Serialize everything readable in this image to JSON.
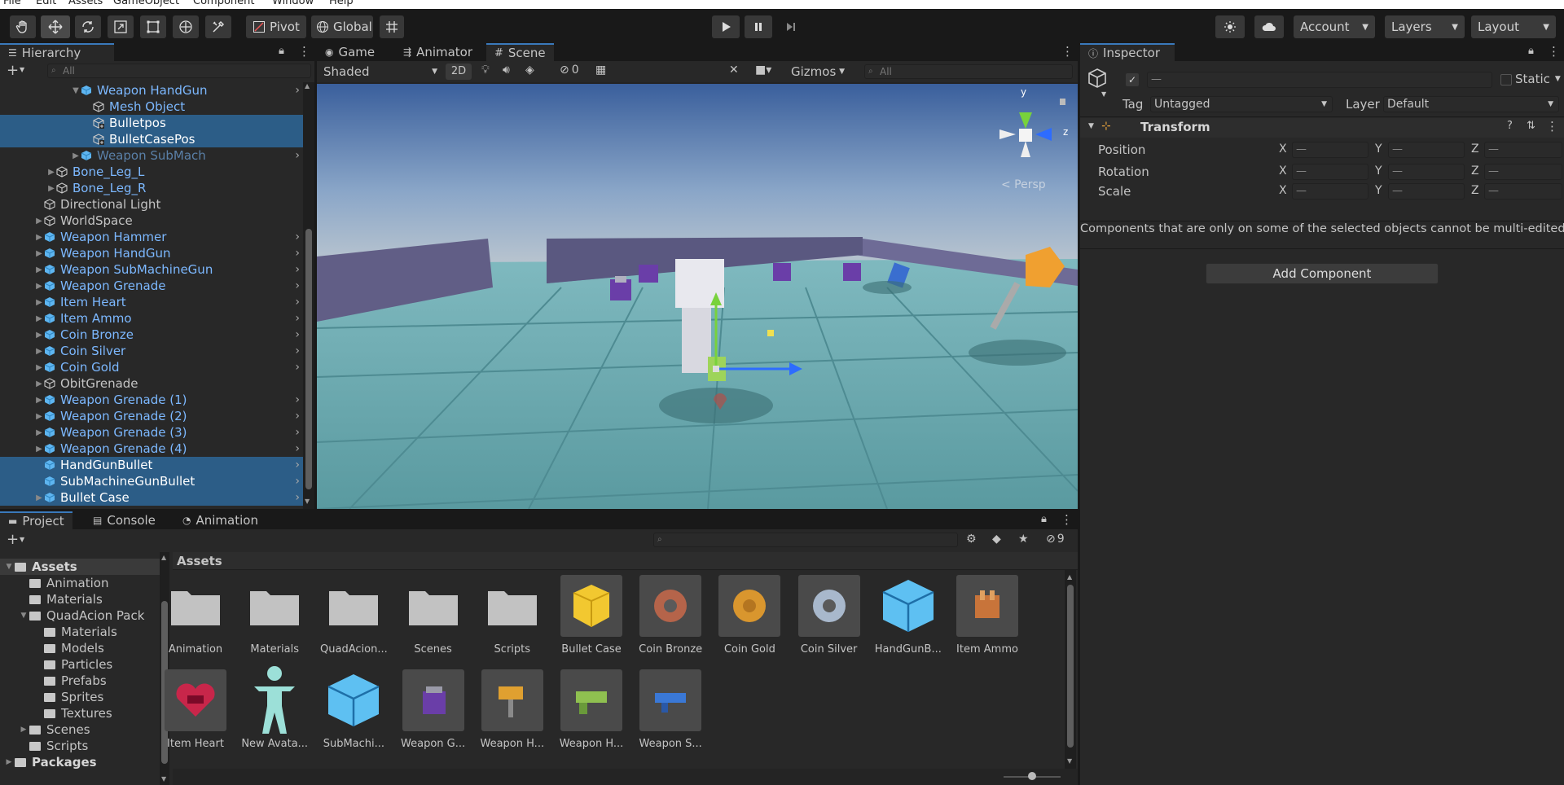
{
  "menu": [
    "File",
    "Edit",
    "Assets",
    "GameObject",
    "Component",
    "Window",
    "Help"
  ],
  "toolbar": {
    "tools": [
      "hand-tool-icon",
      "move-tool-icon",
      "rotate-tool-icon",
      "scale-tool-icon",
      "rect-tool-icon",
      "transform-tool-icon",
      "custom-tool-icon"
    ],
    "pivot": "Pivot",
    "global": "Global",
    "account": "Account",
    "layers": "Layers",
    "layout": "Layout"
  },
  "hierarchy": {
    "tab": "Hierarchy",
    "search_placeholder": "All",
    "items": [
      {
        "label": "Weapon HandGun",
        "indent": 5,
        "expand": "down",
        "style": "blue",
        "more": true,
        "sel": false,
        "icon": "prefab"
      },
      {
        "label": "Mesh Object",
        "indent": 6,
        "expand": "",
        "style": "blue",
        "more": false,
        "sel": false,
        "icon": "gameobject"
      },
      {
        "label": "Bulletpos",
        "indent": 6,
        "expand": "",
        "style": "white",
        "more": false,
        "sel": true,
        "icon": "gameobject-added"
      },
      {
        "label": "BulletCasePos",
        "indent": 6,
        "expand": "",
        "style": "white",
        "more": false,
        "sel": true,
        "icon": "gameobject-added"
      },
      {
        "label": "Weapon SubMach",
        "indent": 5,
        "expand": "right",
        "style": "dim",
        "more": true,
        "sel": false,
        "icon": "prefab"
      },
      {
        "label": "Bone_Leg_L",
        "indent": 3,
        "expand": "right",
        "style": "blue",
        "more": false,
        "sel": false,
        "icon": "gameobject"
      },
      {
        "label": "Bone_Leg_R",
        "indent": 3,
        "expand": "right",
        "style": "blue",
        "more": false,
        "sel": false,
        "icon": "gameobject"
      },
      {
        "label": "Directional Light",
        "indent": 2,
        "expand": "",
        "style": "normal",
        "more": false,
        "sel": false,
        "icon": "gameobject"
      },
      {
        "label": "WorldSpace",
        "indent": 2,
        "expand": "right",
        "style": "normal",
        "more": false,
        "sel": false,
        "icon": "gameobject"
      },
      {
        "label": "Weapon Hammer",
        "indent": 2,
        "expand": "right",
        "style": "blue",
        "more": true,
        "sel": false,
        "icon": "prefab"
      },
      {
        "label": "Weapon HandGun",
        "indent": 2,
        "expand": "right",
        "style": "blue",
        "more": true,
        "sel": false,
        "icon": "prefab"
      },
      {
        "label": "Weapon SubMachineGun",
        "indent": 2,
        "expand": "right",
        "style": "blue",
        "more": true,
        "sel": false,
        "icon": "prefab"
      },
      {
        "label": "Weapon Grenade",
        "indent": 2,
        "expand": "right",
        "style": "blue",
        "more": true,
        "sel": false,
        "icon": "prefab"
      },
      {
        "label": "Item Heart",
        "indent": 2,
        "expand": "right",
        "style": "blue",
        "more": true,
        "sel": false,
        "icon": "prefab"
      },
      {
        "label": "Item Ammo",
        "indent": 2,
        "expand": "right",
        "style": "blue",
        "more": true,
        "sel": false,
        "icon": "prefab"
      },
      {
        "label": "Coin Bronze",
        "indent": 2,
        "expand": "right",
        "style": "blue",
        "more": true,
        "sel": false,
        "icon": "prefab"
      },
      {
        "label": "Coin Silver",
        "indent": 2,
        "expand": "right",
        "style": "blue",
        "more": true,
        "sel": false,
        "icon": "prefab"
      },
      {
        "label": "Coin Gold",
        "indent": 2,
        "expand": "right",
        "style": "blue",
        "more": true,
        "sel": false,
        "icon": "prefab"
      },
      {
        "label": "ObitGrenade",
        "indent": 2,
        "expand": "right",
        "style": "normal",
        "more": false,
        "sel": false,
        "icon": "gameobject"
      },
      {
        "label": "Weapon Grenade (1)",
        "indent": 2,
        "expand": "right",
        "style": "blue",
        "more": true,
        "sel": false,
        "icon": "prefab"
      },
      {
        "label": "Weapon Grenade (2)",
        "indent": 2,
        "expand": "right",
        "style": "blue",
        "more": true,
        "sel": false,
        "icon": "prefab"
      },
      {
        "label": "Weapon Grenade (3)",
        "indent": 2,
        "expand": "right",
        "style": "blue",
        "more": true,
        "sel": false,
        "icon": "prefab"
      },
      {
        "label": "Weapon Grenade (4)",
        "indent": 2,
        "expand": "right",
        "style": "blue",
        "more": true,
        "sel": false,
        "icon": "prefab"
      },
      {
        "label": "HandGunBullet",
        "indent": 2,
        "expand": "",
        "style": "white",
        "more": true,
        "sel": true,
        "icon": "prefab"
      },
      {
        "label": "SubMachineGunBullet",
        "indent": 2,
        "expand": "",
        "style": "white",
        "more": true,
        "sel": true,
        "icon": "prefab"
      },
      {
        "label": "Bullet Case",
        "indent": 2,
        "expand": "right",
        "style": "white",
        "more": true,
        "sel": true,
        "icon": "prefab"
      }
    ]
  },
  "scene": {
    "tabs": {
      "game": "Game",
      "animator": "Animator",
      "scene": "Scene"
    },
    "shading": "Shaded",
    "mode_2d": "2D",
    "hidden_count": "0",
    "gizmos": "Gizmos",
    "search_placeholder": "All",
    "persp": "< Persp",
    "axis_y": "y",
    "axis_z": "z"
  },
  "inspector": {
    "tab": "Inspector",
    "name_value": "—",
    "static": "Static",
    "tag_label": "Tag",
    "tag_value": "Untagged",
    "layer_label": "Layer",
    "layer_value": "Default",
    "component": "Transform",
    "rows": [
      {
        "label": "Position",
        "x": "—",
        "y": "—",
        "z": "—"
      },
      {
        "label": "Rotation",
        "x": "—",
        "y": "—",
        "z": "—"
      },
      {
        "label": "Scale",
        "x": "—",
        "y": "—",
        "z": "—"
      }
    ],
    "axis_x": "X",
    "axis_y": "Y",
    "axis_z": "Z",
    "note": "Components that are only on some of the selected objects cannot be multi-edited.",
    "add_component": "Add Component"
  },
  "project": {
    "tabs": {
      "project": "Project",
      "console": "Console",
      "animation": "Animation"
    },
    "hidden_count": "9",
    "breadcrumb": "Assets",
    "tree": [
      {
        "label": "Assets",
        "indent": 0,
        "expand": "down",
        "bold": true,
        "sel": true
      },
      {
        "label": "Animation",
        "indent": 1,
        "expand": "",
        "bold": false,
        "sel": false
      },
      {
        "label": "Materials",
        "indent": 1,
        "expand": "",
        "bold": false,
        "sel": false
      },
      {
        "label": "QuadAcion Pack",
        "indent": 1,
        "expand": "down",
        "bold": false,
        "sel": false
      },
      {
        "label": "Materials",
        "indent": 2,
        "expand": "",
        "bold": false,
        "sel": false
      },
      {
        "label": "Models",
        "indent": 2,
        "expand": "",
        "bold": false,
        "sel": false
      },
      {
        "label": "Particles",
        "indent": 2,
        "expand": "",
        "bold": false,
        "sel": false
      },
      {
        "label": "Prefabs",
        "indent": 2,
        "expand": "",
        "bold": false,
        "sel": false
      },
      {
        "label": "Sprites",
        "indent": 2,
        "expand": "",
        "bold": false,
        "sel": false
      },
      {
        "label": "Textures",
        "indent": 2,
        "expand": "",
        "bold": false,
        "sel": false
      },
      {
        "label": "Scenes",
        "indent": 1,
        "expand": "right",
        "bold": false,
        "sel": false
      },
      {
        "label": "Scripts",
        "indent": 1,
        "expand": "",
        "bold": false,
        "sel": false
      },
      {
        "label": "Packages",
        "indent": 0,
        "expand": "right",
        "bold": true,
        "sel": false
      }
    ],
    "assets": [
      {
        "label": "Animation",
        "kind": "folder"
      },
      {
        "label": "Materials",
        "kind": "folder"
      },
      {
        "label": "QuadAcion...",
        "kind": "folder"
      },
      {
        "label": "Scenes",
        "kind": "folder"
      },
      {
        "label": "Scripts",
        "kind": "folder"
      },
      {
        "label": "Bullet Case",
        "kind": "bullet-case"
      },
      {
        "label": "Coin Bronze",
        "kind": "coin-bronze"
      },
      {
        "label": "Coin Gold",
        "kind": "coin-gold"
      },
      {
        "label": "Coin Silver",
        "kind": "coin-silver"
      },
      {
        "label": "HandGunB...",
        "kind": "prefab-cube"
      },
      {
        "label": "Item Ammo",
        "kind": "ammo"
      },
      {
        "label": "Item Heart",
        "kind": "heart"
      },
      {
        "label": "New Avata...",
        "kind": "avatar"
      },
      {
        "label": "SubMachi...",
        "kind": "prefab-cube"
      },
      {
        "label": "Weapon G...",
        "kind": "grenade"
      },
      {
        "label": "Weapon H...",
        "kind": "hammer"
      },
      {
        "label": "Weapon H...",
        "kind": "handgun"
      },
      {
        "label": "Weapon S...",
        "kind": "submachinegun"
      }
    ],
    "zoom_slider": 0.5
  },
  "colors": {
    "selection": "#2c5d87",
    "prefab_text": "#7cb8ff",
    "accent": "#3a79bb"
  }
}
